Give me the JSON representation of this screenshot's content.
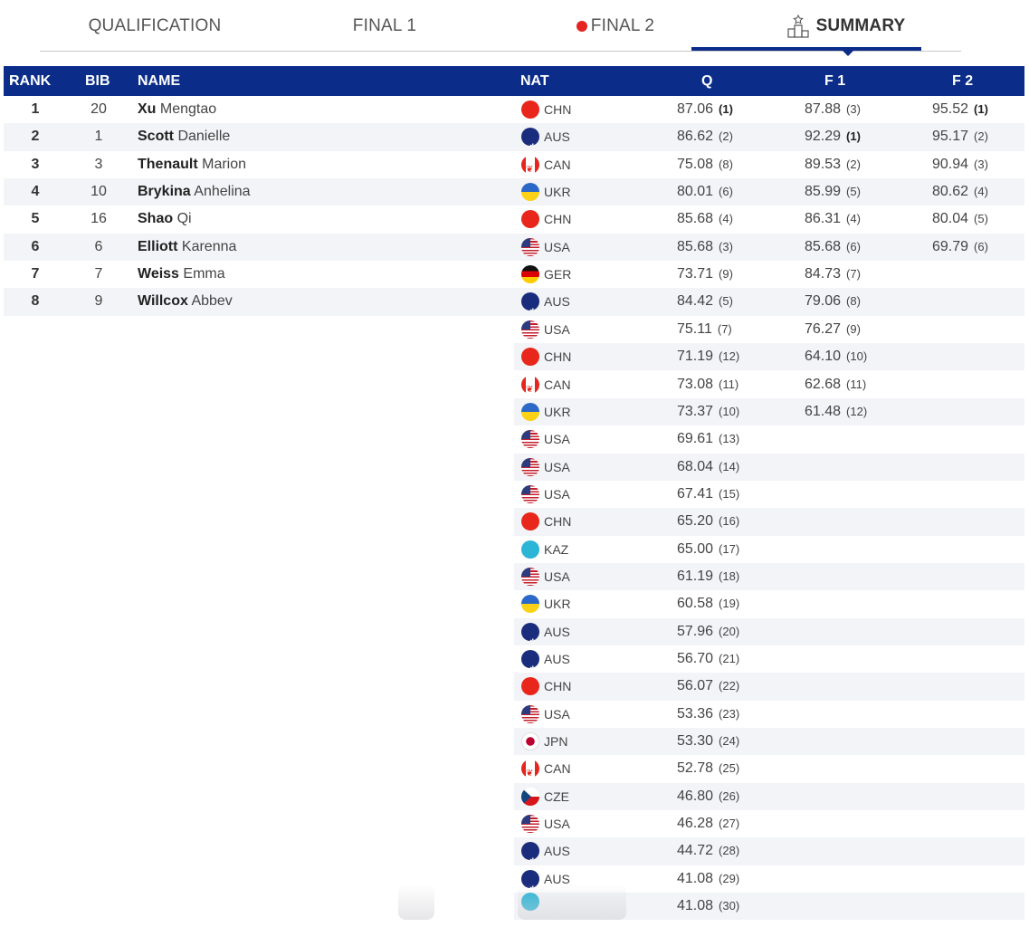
{
  "tabs": [
    {
      "label": "QUALIFICATION",
      "active": false
    },
    {
      "label": "FINAL 1",
      "active": false
    },
    {
      "label": "FINAL 2",
      "active": false,
      "live": true
    },
    {
      "label": "SUMMARY",
      "active": true,
      "icon": "podium-icon"
    }
  ],
  "table": {
    "headers": {
      "rank": "RANK",
      "sort_icon": "▾",
      "bib": "BIB",
      "name": "NAME",
      "nat": "NAT",
      "q": "Q",
      "f1": "F 1",
      "f2": "F 2"
    },
    "rows": [
      {
        "rank": "1",
        "bib": "20",
        "surname": "Xu",
        "given": "Mengtao",
        "nat": "CHN",
        "q": "87.06",
        "q_pos": "(1)",
        "q_bold": true,
        "f1": "87.88",
        "f1_pos": "(3)",
        "f1_bold": false,
        "f2": "95.52",
        "f2_pos": "(1)",
        "f2_bold": true
      },
      {
        "rank": "2",
        "bib": "1",
        "surname": "Scott",
        "given": "Danielle",
        "nat": "AUS",
        "q": "86.62",
        "q_pos": "(2)",
        "q_bold": false,
        "f1": "92.29",
        "f1_pos": "(1)",
        "f1_bold": true,
        "f2": "95.17",
        "f2_pos": "(2)",
        "f2_bold": false
      },
      {
        "rank": "3",
        "bib": "3",
        "surname": "Thenault",
        "given": "Marion",
        "nat": "CAN",
        "q": "75.08",
        "q_pos": "(8)",
        "q_bold": false,
        "f1": "89.53",
        "f1_pos": "(2)",
        "f1_bold": false,
        "f2": "90.94",
        "f2_pos": "(3)",
        "f2_bold": false
      },
      {
        "rank": "4",
        "bib": "10",
        "surname": "Brykina",
        "given": "Anhelina",
        "nat": "UKR",
        "q": "80.01",
        "q_pos": "(6)",
        "q_bold": false,
        "f1": "85.99",
        "f1_pos": "(5)",
        "f1_bold": false,
        "f2": "80.62",
        "f2_pos": "(4)",
        "f2_bold": false
      },
      {
        "rank": "5",
        "bib": "16",
        "surname": "Shao",
        "given": "Qi",
        "nat": "CHN",
        "q": "85.68",
        "q_pos": "(4)",
        "q_bold": false,
        "f1": "86.31",
        "f1_pos": "(4)",
        "f1_bold": false,
        "f2": "80.04",
        "f2_pos": "(5)",
        "f2_bold": false
      },
      {
        "rank": "6",
        "bib": "6",
        "surname": "Elliott",
        "given": "Karenna",
        "nat": "USA",
        "q": "85.68",
        "q_pos": "(3)",
        "q_bold": false,
        "f1": "85.68",
        "f1_pos": "(6)",
        "f1_bold": false,
        "f2": "69.79",
        "f2_pos": "(6)",
        "f2_bold": false
      },
      {
        "rank": "7",
        "bib": "7",
        "surname": "Weiss",
        "given": "Emma",
        "nat": "GER",
        "q": "73.71",
        "q_pos": "(9)",
        "q_bold": false,
        "f1": "84.73",
        "f1_pos": "(7)",
        "f1_bold": false,
        "f2": "",
        "f2_pos": "",
        "f2_bold": false
      },
      {
        "rank": "8",
        "bib": "9",
        "surname": "Willcox",
        "given": "Abbev",
        "nat": "AUS",
        "q": "84.42",
        "q_pos": "(5)",
        "q_bold": false,
        "f1": "79.06",
        "f1_pos": "(8)",
        "f1_bold": false,
        "f2": "",
        "f2_pos": "",
        "f2_bold": false
      },
      {
        "nat": "USA",
        "q": "75.11",
        "q_pos": "(7)",
        "f1": "76.27",
        "f1_pos": "(9)"
      },
      {
        "nat": "CHN",
        "q": "71.19",
        "q_pos": "(12)",
        "f1": "64.10",
        "f1_pos": "(10)"
      },
      {
        "nat": "CAN",
        "q": "73.08",
        "q_pos": "(11)",
        "f1": "62.68",
        "f1_pos": "(11)"
      },
      {
        "nat": "UKR",
        "q": "73.37",
        "q_pos": "(10)",
        "f1": "61.48",
        "f1_pos": "(12)"
      },
      {
        "nat": "USA",
        "q": "69.61",
        "q_pos": "(13)"
      },
      {
        "nat": "USA",
        "q": "68.04",
        "q_pos": "(14)"
      },
      {
        "nat": "USA",
        "q": "67.41",
        "q_pos": "(15)"
      },
      {
        "nat": "CHN",
        "q": "65.20",
        "q_pos": "(16)"
      },
      {
        "nat": "KAZ",
        "q": "65.00",
        "q_pos": "(17)"
      },
      {
        "nat": "USA",
        "q": "61.19",
        "q_pos": "(18)"
      },
      {
        "nat": "UKR",
        "q": "60.58",
        "q_pos": "(19)"
      },
      {
        "nat": "AUS",
        "q": "57.96",
        "q_pos": "(20)"
      },
      {
        "nat": "AUS",
        "q": "56.70",
        "q_pos": "(21)"
      },
      {
        "nat": "CHN",
        "q": "56.07",
        "q_pos": "(22)"
      },
      {
        "nat": "USA",
        "q": "53.36",
        "q_pos": "(23)"
      },
      {
        "nat": "JPN",
        "q": "53.30",
        "q_pos": "(24)"
      },
      {
        "nat": "CAN",
        "q": "52.78",
        "q_pos": "(25)"
      },
      {
        "nat": "CZE",
        "q": "46.80",
        "q_pos": "(26)"
      },
      {
        "nat": "USA",
        "q": "46.28",
        "q_pos": "(27)"
      },
      {
        "nat": "AUS",
        "q": "44.72",
        "q_pos": "(28)"
      },
      {
        "nat": "AUS",
        "q": "41.08",
        "q_pos": "(29)"
      },
      {
        "nat": "",
        "q": "41.08",
        "q_pos": "(30)"
      }
    ]
  },
  "colors": {
    "header_bg": "#0b2d89",
    "row_alt": "#f3f4f8",
    "live_dot": "#e42420"
  }
}
